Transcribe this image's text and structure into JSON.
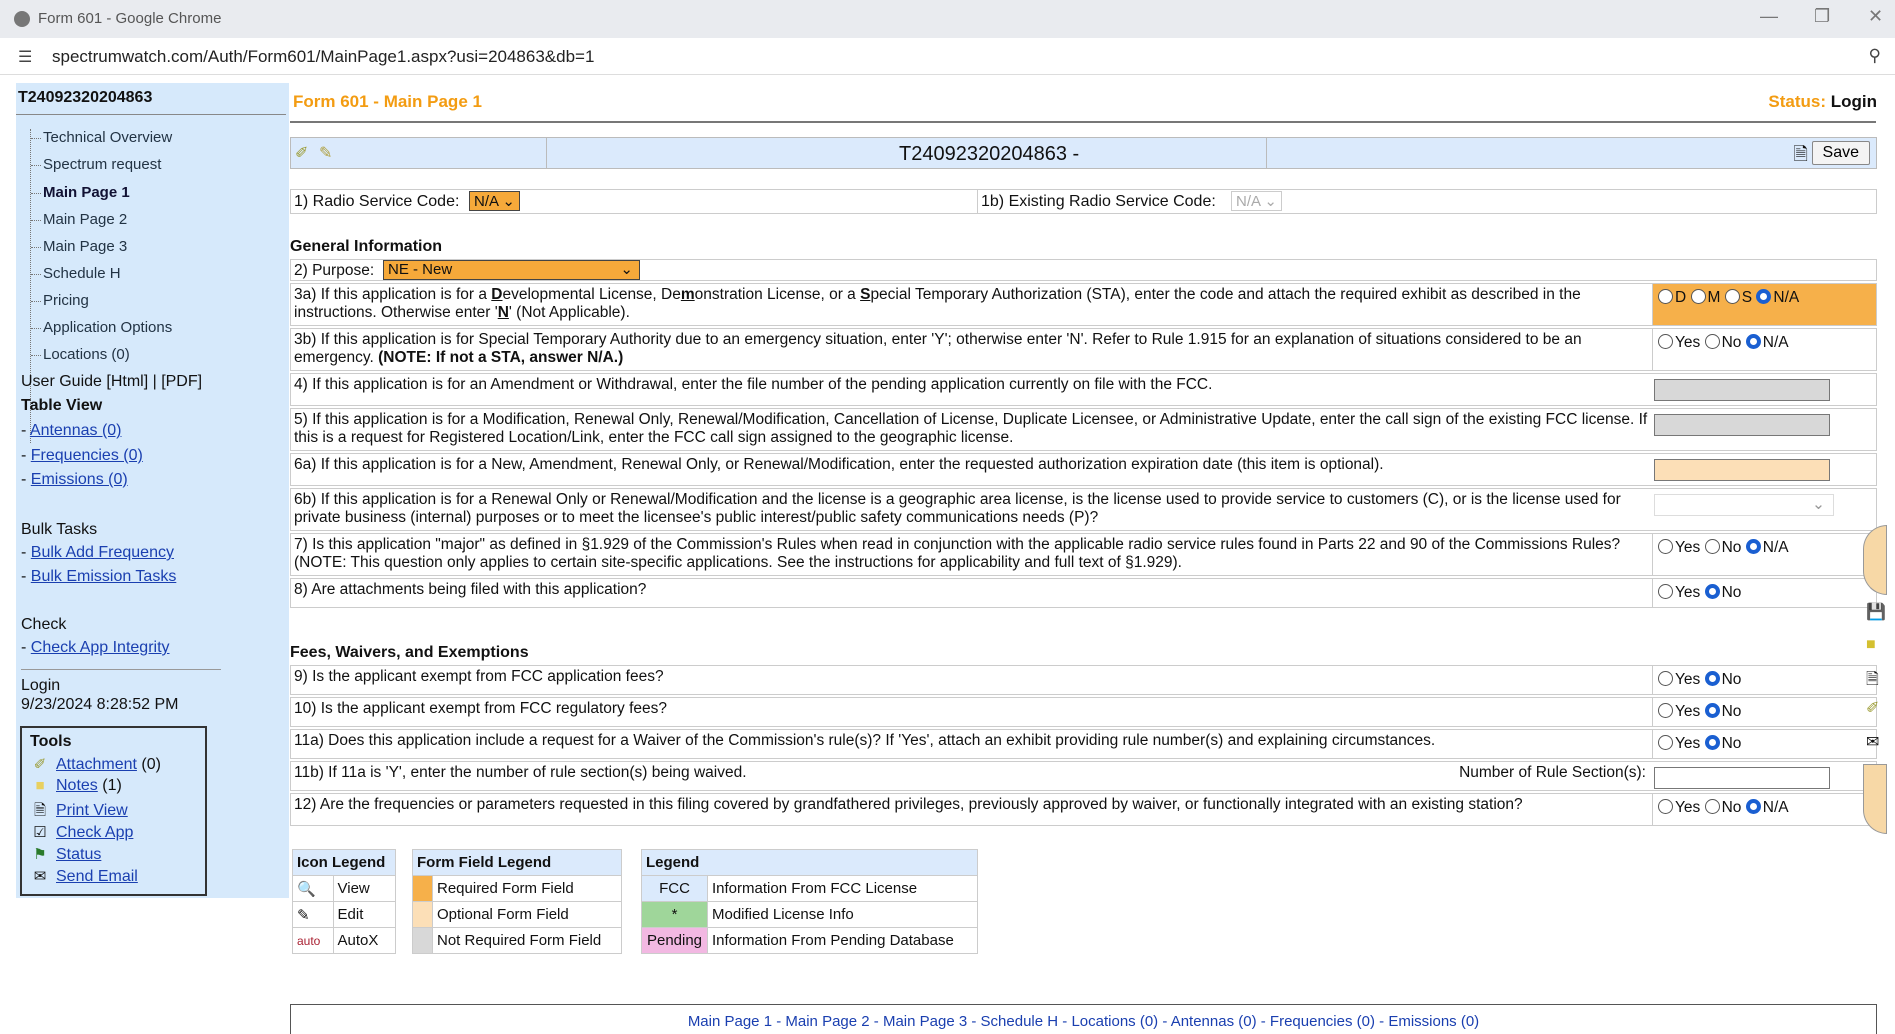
{
  "browser": {
    "title": "Form 601 - Google Chrome",
    "url": "spectrumwatch.com/Auth/Form601/MainPage1.aspx?usi=204863&db=1"
  },
  "sidebar": {
    "app_id": "T24092320204863",
    "tree": [
      "Technical Overview",
      "Spectrum request",
      "Main Page 1",
      "Main Page 2",
      "Main Page 3",
      "Schedule H",
      "Pricing",
      "Application Options",
      "Locations (0)"
    ],
    "user_guide": "User Guide [Html] | [PDF]",
    "table_view": "Table View",
    "table_links": [
      "Antennas (0)",
      "Frequencies (0)",
      "Emissions (0)"
    ],
    "bulk_title": "Bulk Tasks",
    "bulk_links": [
      "Bulk Add Frequency",
      "Bulk Emission Tasks"
    ],
    "check_title": "Check",
    "check_link": "Check App Integrity",
    "login_label": "Login",
    "login_time": "9/23/2024 8:28:52 PM",
    "tools_title": "Tools",
    "tools": [
      {
        "label": "Attachment",
        "suffix": " (0)",
        "icon": "paperclip-icon"
      },
      {
        "label": "Notes",
        "suffix": " (1)",
        "icon": "note-icon"
      },
      {
        "label": "Print View",
        "suffix": "",
        "icon": "print-icon"
      },
      {
        "label": "Check App",
        "suffix": "",
        "icon": "check-icon"
      },
      {
        "label": "Status",
        "suffix": "",
        "icon": "flag-icon"
      },
      {
        "label": "Send Email",
        "suffix": "",
        "icon": "email-icon"
      }
    ]
  },
  "main": {
    "page_title": "Form 601 - Main Page 1",
    "status_label": "Status:",
    "status_value": "Login",
    "app_number": "T24092320204863 -",
    "save_label": "Save",
    "radio_service_label": "1) Radio Service Code:",
    "radio_service_value": "N/A",
    "existing_service_label": "1b) Existing Radio Service Code:",
    "existing_service_value": "N/A",
    "general_info": "General Information",
    "purpose_label": "2) Purpose:",
    "purpose_value": "NE - New",
    "fees_title": "Fees, Waivers, and Exemptions"
  },
  "questions": {
    "q3a_html": "3a) If this application is for a <b><u>D</u></b>evelopmental License, De<b><u>m</u></b>onstration License, or a <b><u>S</u></b>pecial Temporary Authorization (STA), enter the code and attach the required exhibit as described in the instructions. Otherwise enter '<b><u>N</u></b>' (Not Applicable).",
    "q3b_html": "3b) If this application is for Special Temporary Authority due to an emergency situation, enter 'Y'; otherwise enter 'N'. Refer to Rule 1.915 for an explanation of situations considered to be an emergency. <b>(NOTE: If not a STA, answer N/A.)</b>",
    "q4": "4) If this application is for an Amendment or Withdrawal, enter the file number of the pending application currently on file with the FCC.",
    "q5": "5) If this application is for a Modification, Renewal Only, Renewal/Modification, Cancellation of License, Duplicate Licensee, or Administrative Update, enter the call sign of the existing FCC license. If this is a request for Registered Location/Link, enter the FCC call sign assigned to the geographic license.",
    "q6a": "6a) If this application is for a New, Amendment, Renewal Only, or Renewal/Modification, enter the requested authorization expiration date (this item is optional).",
    "q6b": "6b) If this application is for a Renewal Only or Renewal/Modification and the license is a geographic area license, is the license used to provide service to customers (C), or is the license used for private business (internal) purposes or to meet the licensee's public interest/public safety communications needs (P)?",
    "q7": "7) Is this application \"major\" as defined in §1.929 of the Commission's Rules when read in conjunction with the applicable radio service rules found in Parts 22 and 90 of the Commissions Rules? (NOTE: This question only applies to certain site-specific applications. See the instructions for applicability and full text of §1.929).",
    "q8": "8) Are attachments being filed with this application?",
    "q9": "9) Is the applicant exempt from FCC application fees?",
    "q10": "10) Is the applicant exempt from FCC regulatory fees?",
    "q11a": "11a) Does this application include a request for a Waiver of the Commission's rule(s)?  If 'Yes', attach an exhibit providing rule number(s) and explaining circumstances.",
    "q11b": "11b) If 11a is 'Y', enter the number of rule section(s) being waived.",
    "q11b_right": "Number of Rule Section(s):",
    "q12": "12) Are the frequencies or parameters requested in this filing covered by grandfathered privileges, previously approved by waiver, or functionally integrated with an existing station?",
    "opt_d": "D",
    "opt_m": "M",
    "opt_s": "S",
    "opt_na": "N/A",
    "opt_yes": "Yes",
    "opt_no": "No"
  },
  "legends": {
    "icon_title": "Icon Legend",
    "icon_view": "View",
    "icon_edit": "Edit",
    "icon_auto": "AutoX",
    "auto_glyph": "auto",
    "field_title": "Form Field Legend",
    "field_req": "Required Form Field",
    "field_opt": "Optional Form Field",
    "field_not": "Not Required Form Field",
    "legend_title": "Legend",
    "fcc_tag": "FCC",
    "fcc_text": "Information From FCC License",
    "mod_tag": "*",
    "mod_text": "Modified License Info",
    "pend_tag": "Pending",
    "pend_text": "Information From Pending Database"
  },
  "footer_nav": [
    "Main Page 1",
    "Main Page 2",
    "Main Page 3",
    "Schedule H",
    "Locations (0)",
    "Antennas (0)",
    "Frequencies (0)",
    "Emissions (0)"
  ],
  "colors": {
    "required": "#f6b04a",
    "optional": "#fcdfb7",
    "sidebar": "#d6e9fb",
    "title": "#f39c12"
  }
}
